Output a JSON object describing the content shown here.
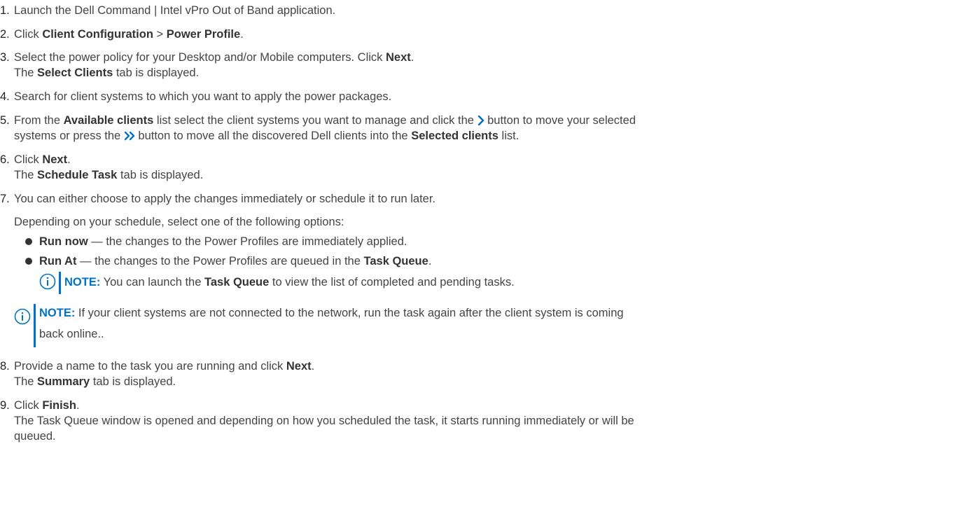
{
  "steps": [
    {
      "number": "1.",
      "text": "Launch the Dell Command | Intel vPro Out of Band application."
    },
    {
      "number": "2.",
      "pre": "Click ",
      "b1": "Client Configuration",
      "mid": " > ",
      "b2": "Power Profile",
      "post": "."
    },
    {
      "number": "3.",
      "pre": "Select the power policy for your Desktop and/or Mobile computers. Click ",
      "b1": "Next",
      "post": ".",
      "line2_pre": "The ",
      "line2_b": "Select Clients",
      "line2_post": " tab is displayed."
    },
    {
      "number": "4.",
      "text": "Search for client systems to which you want to apply the power packages."
    },
    {
      "number": "5.",
      "pre": "From the ",
      "b1": "Available clients",
      "mid": " list select the client systems you want to manage and click the ",
      "post": " button to move your selected",
      "line2_pre": "systems or press the ",
      "line2_mid": " button to move all the discovered Dell clients into the ",
      "line2_b": "Selected clients",
      "line2_post": " list.",
      "single_icon": "chevron-right-icon",
      "double_icon": "double-chevron-right-icon"
    },
    {
      "number": "6.",
      "pre": "Click ",
      "b1": "Next",
      "post": ".",
      "line2_pre": "The ",
      "line2_b": "Schedule Task",
      "line2_post": " tab is displayed."
    },
    {
      "number": "7.",
      "text": "You can either choose to apply the changes immediately or schedule it to run later.",
      "line2": "Depending on your schedule, select one of the following options:",
      "options": [
        {
          "label": "Run now",
          "text": " — the changes to the Power Profiles are immediately applied."
        },
        {
          "label": "Run At",
          "text": " — the changes to the Power Profiles are queued in the ",
          "bold_end": "Task Queue",
          "end": "."
        }
      ],
      "note1": {
        "label": "NOTE:",
        "pre": " You can launch the ",
        "bold": "Task Queue",
        "post": " to view the list of completed and pending tasks."
      },
      "note2": {
        "label": "NOTE:",
        "text": " If your client systems are not connected to the network, run the task again after the client system is coming",
        "line2": "back online.."
      }
    },
    {
      "number": "8.",
      "pre": "Provide a name to the task you are running and click ",
      "b1": "Next",
      "post": ".",
      "line2_pre": "The ",
      "line2_b": "Summary",
      "line2_post": " tab is displayed."
    },
    {
      "number": "9.",
      "pre": "Click ",
      "b1": "Finish",
      "post": ".",
      "line2": "The Task Queue window is opened and depending on how you scheduled the task, it starts running immediately or will be",
      "line3": "queued."
    }
  ],
  "colors": {
    "accent": "#0072c6",
    "text": "#444444"
  }
}
